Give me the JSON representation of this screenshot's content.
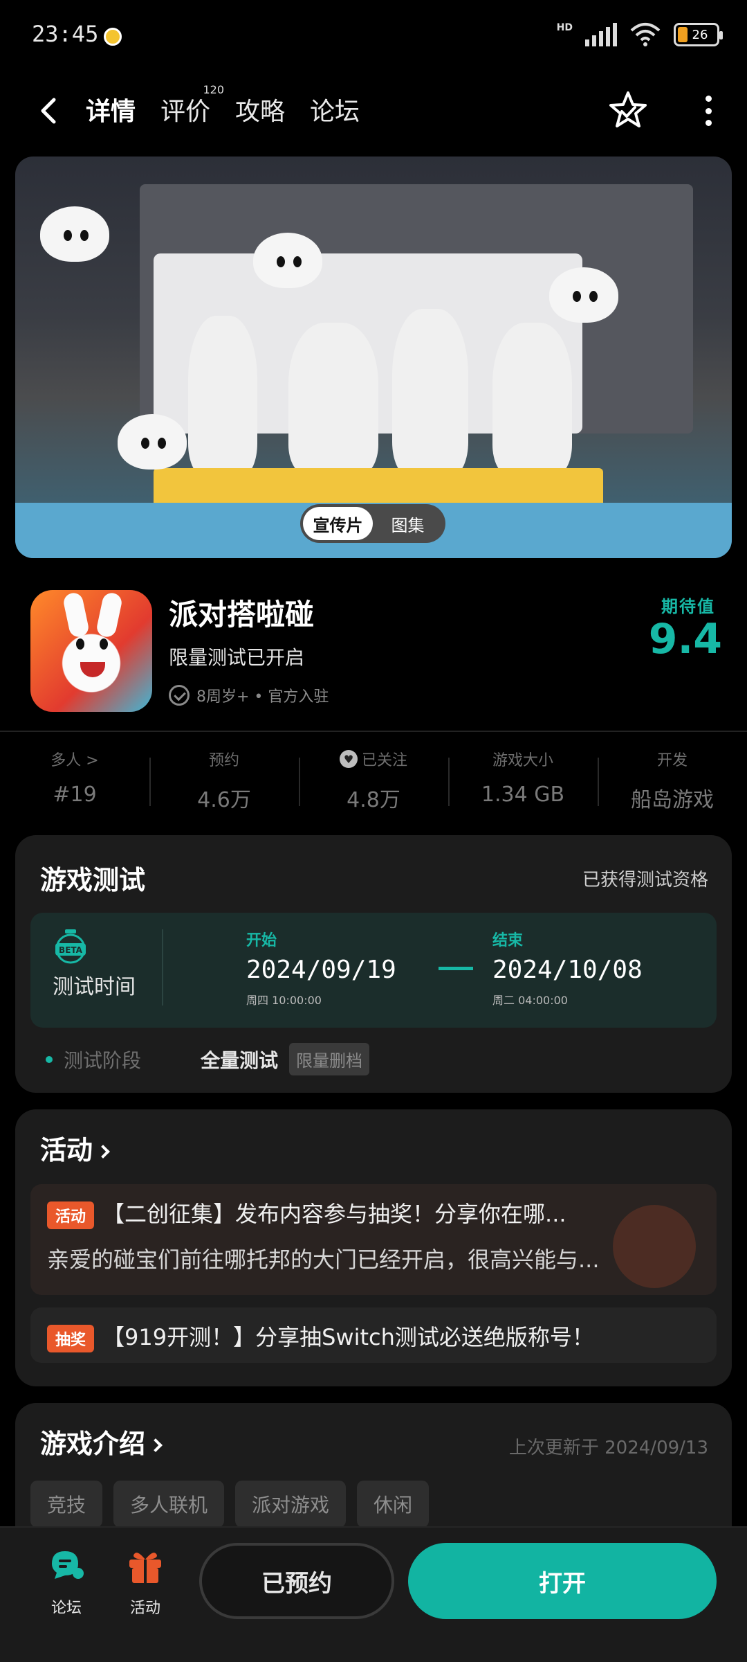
{
  "status": {
    "time": "23:45",
    "network": "HD",
    "battery": "26",
    "battery_level": 0.26
  },
  "nav": {
    "tabs": [
      {
        "label": "详情",
        "active": true
      },
      {
        "label": "评价",
        "badge": "120"
      },
      {
        "label": "攻略"
      },
      {
        "label": "论坛"
      }
    ]
  },
  "banner": {
    "toggle": [
      "宣传片",
      "图集"
    ],
    "selected": "宣传片"
  },
  "app": {
    "name": "派对搭啦碰",
    "subtitle": "限量测试已开启",
    "meta": "8周岁+ • 官方入驻",
    "expect_label": "期待值",
    "expect_score": "9.4"
  },
  "stats": [
    {
      "label": "多人 >",
      "value": "#19"
    },
    {
      "label": "预约",
      "value": "4.6万"
    },
    {
      "label": "已关注",
      "value": "4.8万"
    },
    {
      "label": "游戏大小",
      "value": "1.34 GB"
    },
    {
      "label": "开发",
      "value": "船岛游戏"
    }
  ],
  "test": {
    "title": "游戏测试",
    "status": "已获得测试资格",
    "time_label": "测试时间",
    "badge": "BETA",
    "start_label": "开始",
    "start_date": "2024/09/19",
    "start_time": "周四 10:00:00",
    "end_label": "结束",
    "end_date": "2024/10/08",
    "end_time": "周二 04:00:00",
    "stage_label": "测试阶段",
    "stage_value": "全量测试",
    "stage_tag": "限量删档"
  },
  "activities": {
    "title": "活动",
    "items": [
      {
        "tag": "活动",
        "title": "【二创征集】发布内容参与抽奖！分享你在哪...",
        "desc": "亲爱的碰宝们前往哪托邦的大门已经开启，很高兴能与..."
      },
      {
        "tag": "抽奖",
        "title": "【919开测！】分享抽Switch测试必送绝版称号！"
      }
    ]
  },
  "intro": {
    "title": "游戏介绍",
    "updated": "上次更新于 2024/09/13",
    "tags": [
      "竞技",
      "多人联机",
      "派对游戏",
      "休闲"
    ]
  },
  "bottom": {
    "forum_label": "论坛",
    "activity_label": "活动",
    "reserved_label": "已预约",
    "open_label": "打开"
  },
  "colors": {
    "accent": "#12b4a2",
    "orange": "#e9582b",
    "background": "#000000"
  }
}
